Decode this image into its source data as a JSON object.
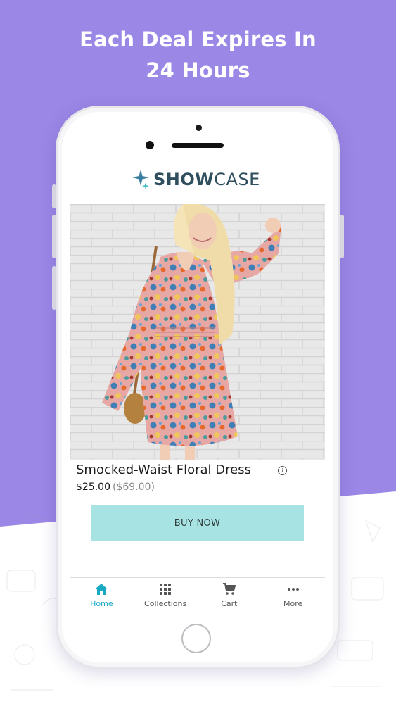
{
  "headline": {
    "line1": "Each Deal Expires In",
    "line2": "24 Hours"
  },
  "app": {
    "logo_bold": "SHOW",
    "logo_light": "CASE",
    "logo_icon": "sparkle-stars-icon"
  },
  "product": {
    "title": "Smocked-Waist Floral Dress",
    "price": "$25.00",
    "original_price": "($69.00)",
    "info_icon": "info-icon",
    "buy_label": "BUY NOW"
  },
  "tabbar": {
    "items": [
      {
        "label": "Home",
        "icon": "home-icon",
        "active": true
      },
      {
        "label": "Collections",
        "icon": "grid-icon",
        "active": false
      },
      {
        "label": "Cart",
        "icon": "cart-icon",
        "active": false
      },
      {
        "label": "More",
        "icon": "more-dots-icon",
        "active": false
      }
    ]
  },
  "colors": {
    "background_purple": "#9b87e6",
    "accent_teal": "#1aa9c2",
    "buy_button": "#a8e3e3",
    "logo_text": "#2f4f5f"
  }
}
